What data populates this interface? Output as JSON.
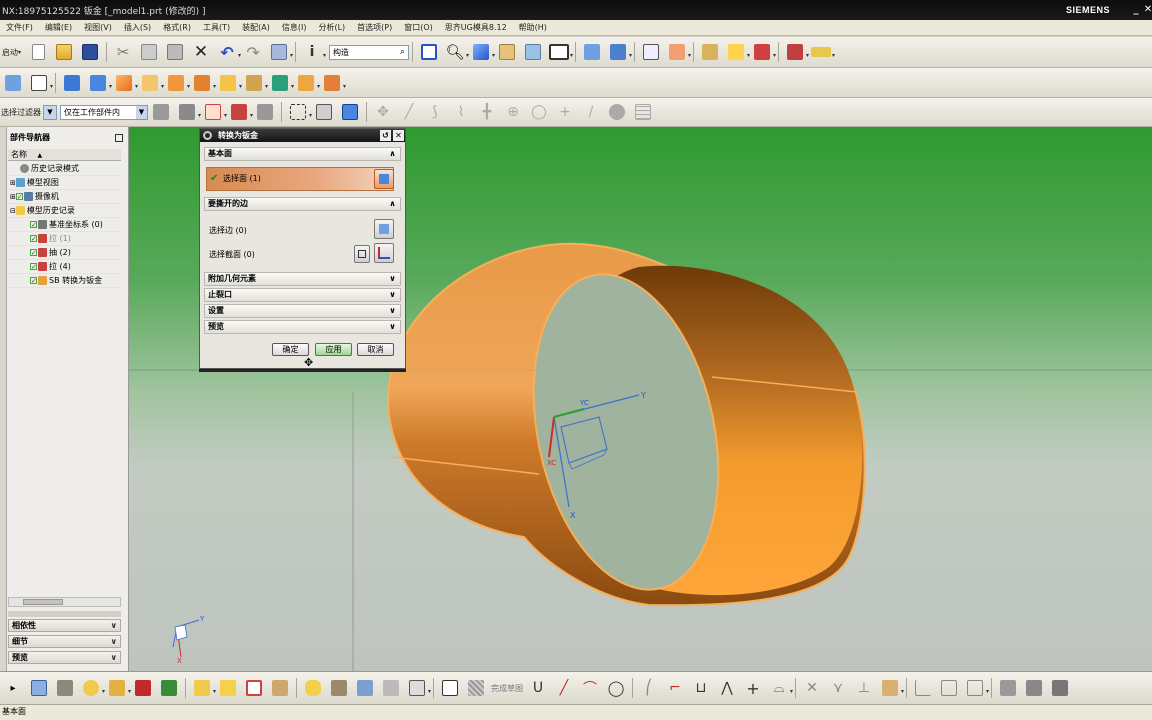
{
  "window": {
    "title": "NX:18975125522   钣金   [_model1.prt  (修改的) ]",
    "brand": "SIEMENS"
  },
  "menu": [
    "文件(F)",
    "编辑(E)",
    "视图(V)",
    "插入(S)",
    "格式(R)",
    "工具(T)",
    "装配(A)",
    "信息(I)",
    "分析(L)",
    "首选项(P)",
    "窗口(O)",
    "思齐UG模具8.12",
    "帮助(H)"
  ],
  "toolbar1": {
    "start_label": "启动",
    "search_value": "构造"
  },
  "toolbar3": {
    "filter_label": "选择过滤器",
    "scope_value": "仅在工作部件内"
  },
  "navigator": {
    "title": "部件导航器",
    "column": "名称",
    "items": [
      {
        "label": "历史记录模式",
        "indent": 1
      },
      {
        "label": "模型视图",
        "indent": 1
      },
      {
        "label": "摄像机",
        "indent": 1
      },
      {
        "label": "模型历史记录",
        "indent": 1
      },
      {
        "label": "基准坐标系 (0)",
        "indent": 2
      },
      {
        "label": "拉 (1)",
        "indent": 2
      },
      {
        "label": "抽 (2)",
        "indent": 2
      },
      {
        "label": "拉 (4)",
        "indent": 2
      },
      {
        "label": "SB 转换为钣金",
        "indent": 2
      }
    ],
    "panels": [
      "相依性",
      "细节",
      "预览"
    ]
  },
  "dialog": {
    "title": "转换为钣金",
    "section_base": "基本面",
    "select_face": "选择面 (1)",
    "section_rip": "要撕开的边",
    "select_edge": "选择边 (0)",
    "select_section": "选择截面 (0)",
    "sections": [
      "附加几何元素",
      "止裂口",
      "设置",
      "预览"
    ],
    "buttons": {
      "ok": "确定",
      "apply": "应用",
      "cancel": "取消"
    }
  },
  "viewport": {
    "axis_labels": {
      "y": "Y",
      "x": "X",
      "yc": "YC",
      "xc": "XC"
    }
  },
  "bottom": {
    "snap_label": "完成草图"
  },
  "status": {
    "message": "基本面"
  },
  "colors": {
    "accent_orange": "#f6a23a",
    "background_green": "#2f9a2f",
    "dialog_bg": "#e8e6df"
  },
  "icons": [
    "folder-open-icon",
    "save-icon",
    "cut-icon",
    "copy-icon",
    "paste-icon",
    "delete-icon",
    "undo-icon",
    "redo-icon",
    "zoom-icon",
    "block-icon",
    "sketch-icon",
    "circle-icon",
    "line-icon",
    "arc-icon",
    "point-icon",
    "rectangle-icon",
    "polyline-icon",
    "close-icon"
  ]
}
